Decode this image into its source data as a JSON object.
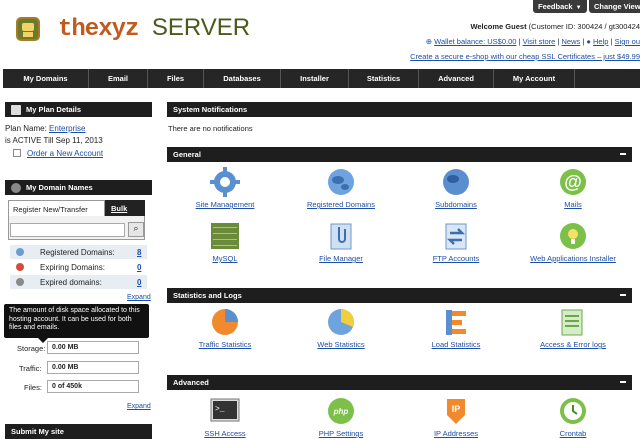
{
  "top": {
    "feedback": "Feedback",
    "change_view": "Change View"
  },
  "brand": {
    "name_part1": "thexyz",
    "name_part2": "SERVER"
  },
  "header": {
    "welcome": "Welcome Guest",
    "customer": "(Customer ID: 300424 / gt300424",
    "wallet": "Wallet balance: US$0.00",
    "visit_store": "Visit store",
    "news": "News",
    "help": "Help",
    "sign_out": "Sign ou",
    "promo": "Create a secure e-shop with our cheap SSL Certificates – just $49.99"
  },
  "nav": [
    "My Domains",
    "Email",
    "Files",
    "Databases",
    "Installer",
    "Statistics",
    "Advanced",
    "My Account"
  ],
  "plan": {
    "title": "My Plan Details",
    "plan_label": "Plan Name:",
    "plan_name": "Enterprise",
    "status": "is ACTIVE Till Sep 11, 2013",
    "order_link": "Order a New Account"
  },
  "domains": {
    "title": "My Domain Names",
    "tab_register": "Register New/Transfer",
    "tab_bulk": "Bulk",
    "search_value": "",
    "rows": [
      {
        "label": "Registered Domains:",
        "count": "8"
      },
      {
        "label": "Expiring Domains:",
        "count": "0"
      },
      {
        "label": "Expired domains:",
        "count": "0"
      }
    ],
    "expand": "Expand"
  },
  "usage": {
    "tooltip": "The amount of disk space allocated to this hosting account. It can be used for both files and emails.",
    "storage_label": "Storage:",
    "storage_value": "0.00 MB",
    "traffic_label": "Traffic:",
    "traffic_value": "0.00 MB",
    "files_label": "Files:",
    "files_value": "0 of 450k",
    "expand": "Expand"
  },
  "submit": {
    "title": "Submit My site"
  },
  "notifications": {
    "title": "System Notifications",
    "text": "There are no notifications"
  },
  "general": {
    "title": "General",
    "items": [
      "Site Management",
      "Registered Domains",
      "Subdomains",
      "Mails",
      "MySQL",
      "File Manager",
      "FTP Accounts",
      "Web Applications Installer"
    ]
  },
  "stats": {
    "title": "Statistics and Logs",
    "items": [
      "Traffic Statistics",
      "Web Statistics",
      "Load Statistics",
      "Access & Error logs"
    ]
  },
  "advanced": {
    "title": "Advanced",
    "items": [
      "SSH Access",
      "PHP Settings",
      "IP Addresses",
      "Crontab"
    ],
    "php_badge": "php",
    "ip_badge": "IP"
  },
  "colors": {
    "header_bg": "#1e1e1e",
    "link": "#1d4fa8",
    "brand_orange": "#c05a1e",
    "brand_green": "#4a5a1a"
  }
}
